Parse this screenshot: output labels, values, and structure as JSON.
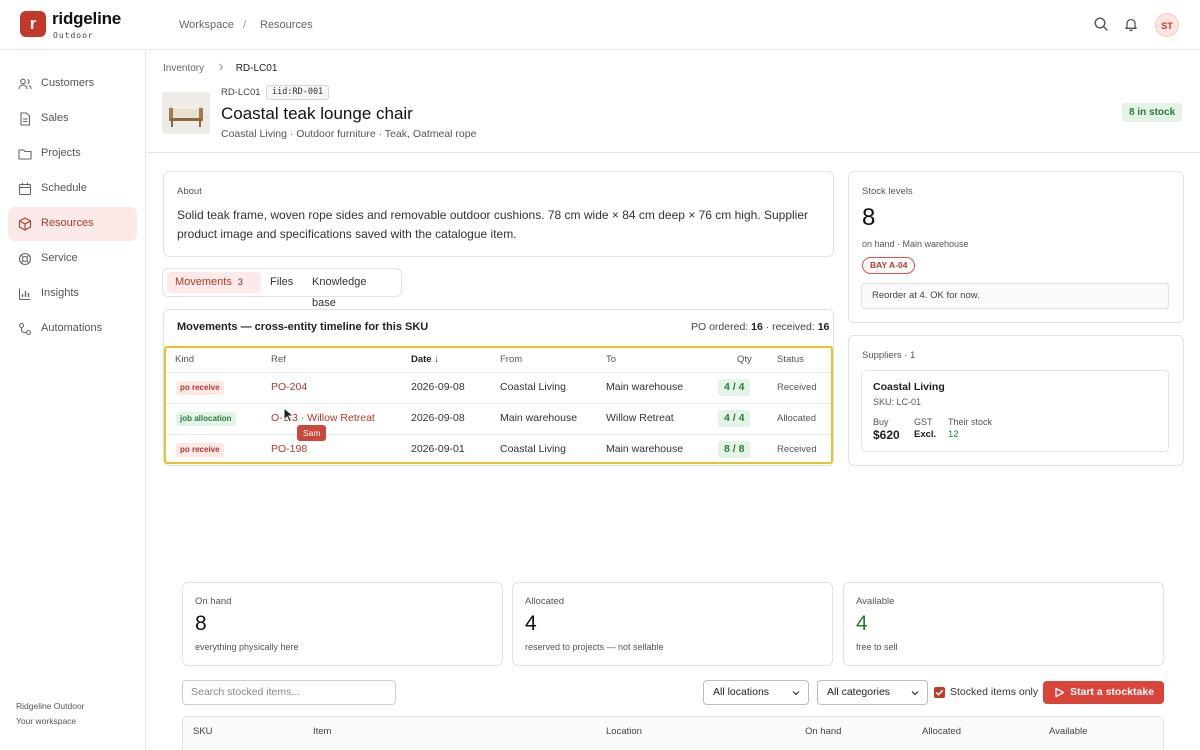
{
  "app": {
    "logo_letter": "r",
    "name": "ridgeline",
    "sub": "Outdoor"
  },
  "top_breadcrumb": {
    "workspace": "Workspace",
    "sep": "/",
    "section": "Resources"
  },
  "user": {
    "initials": "ST"
  },
  "sidebar": {
    "items": [
      {
        "label": "Customers",
        "icon": "users-icon"
      },
      {
        "label": "Sales",
        "icon": "document-icon"
      },
      {
        "label": "Projects",
        "icon": "folder-icon"
      },
      {
        "label": "Schedule",
        "icon": "calendar-icon"
      },
      {
        "label": "Resources",
        "icon": "box-icon",
        "active": true
      },
      {
        "label": "Service",
        "icon": "lifebuoy-icon"
      },
      {
        "label": "Insights",
        "icon": "bar-chart-icon"
      },
      {
        "label": "Automations",
        "icon": "flow-icon"
      }
    ],
    "footer_org": "Ridgeline Outdoor",
    "footer_ws": "Your workspace"
  },
  "breadcrumb": {
    "parent": "Inventory",
    "current": "RD-LC01"
  },
  "item": {
    "sku": "RD-LC01",
    "iid": "iid:RD-001",
    "title": "Coastal teak lounge chair",
    "subtitle": "Coastal Living · Outdoor furniture · Teak, Oatmeal rope",
    "stock_badge": "8 in stock"
  },
  "about": {
    "label": "About",
    "line1": "Solid teak frame, woven rope sides and removable outdoor cushions. 78 cm wide × 84 cm deep × 76 cm high. Supplier",
    "line2": "product image and specifications saved with the catalogue item."
  },
  "tabs": {
    "movements": "Movements",
    "movements_count": "3",
    "files": "Files",
    "kb": "Knowledge base"
  },
  "movements": {
    "title": "Movements — cross-entity timeline for this SKU",
    "po_ordered_label": "PO ordered:",
    "po_ordered": "16",
    "received_label": "· received:",
    "received": "16",
    "headers": {
      "kind": "Kind",
      "ref": "Ref",
      "date": "Date ↓",
      "from": "From",
      "to": "To",
      "qty": "Qty",
      "status": "Status"
    },
    "rows": [
      {
        "kind": "po receive",
        "ref": "PO-204",
        "date": "2026-09-08",
        "from": "Coastal Living",
        "to": "Main warehouse",
        "qty": "4 / 4",
        "status": "Received"
      },
      {
        "kind": "job allocation",
        "ref": "O-1-3 · Willow Retreat",
        "date": "2026-09-08",
        "from": "Main warehouse",
        "to": "Willow Retreat",
        "qty": "4 / 4",
        "status": "Allocated"
      },
      {
        "kind": "po receive",
        "ref": "PO-198",
        "date": "2026-09-01",
        "from": "Coastal Living",
        "to": "Main warehouse",
        "qty": "8 / 8",
        "status": "Received"
      }
    ],
    "tooltip": "Sam"
  },
  "stock_levels": {
    "label": "Stock levels",
    "on_hand": "8",
    "desc": "on hand · Main warehouse",
    "bay": "BAY A-04",
    "reorder": "Reorder at 4. OK for now."
  },
  "suppliers": {
    "label": "Suppliers · 1",
    "name": "Coastal Living",
    "sku": "SKU: LC-01",
    "buy_label": "Buy",
    "buy": "$620",
    "gst_label": "GST",
    "gst": "Excl.",
    "their_label": "Their stock",
    "their": "12"
  },
  "stats": [
    {
      "label": "On hand",
      "value": "8",
      "desc": "everything physically here"
    },
    {
      "label": "Allocated",
      "value": "4",
      "desc": "reserved to projects — not sellable"
    },
    {
      "label": "Available",
      "value": "4",
      "desc": "free to sell"
    }
  ],
  "filters": {
    "search_placeholder": "Search stocked items...",
    "locations": "All locations",
    "categories": "All categories",
    "stocked_only": "Stocked items only",
    "stocktake_button": "Start a stocktake"
  },
  "stock_table": {
    "headers": {
      "sku": "SKU",
      "item": "Item",
      "location": "Location",
      "on_hand": "On hand",
      "allocated": "Allocated",
      "available": "Available"
    }
  },
  "colors": {
    "brand": "#c0392b",
    "accent_bg": "#fbeae7",
    "ok_green": "#2c7a3a",
    "highlight": "#e6c32a"
  }
}
